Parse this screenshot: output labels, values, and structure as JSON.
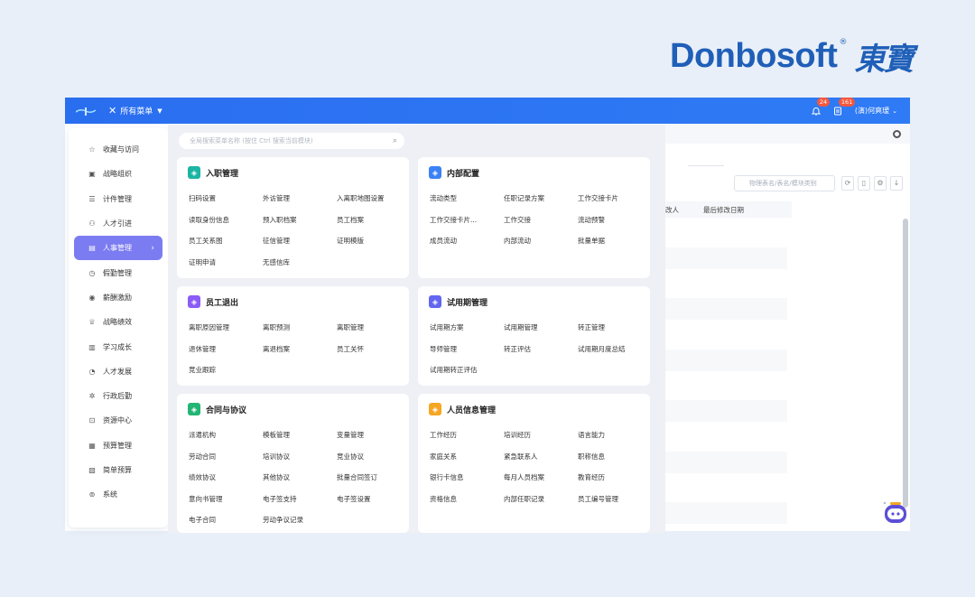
{
  "brand": {
    "name": "Donbosoft",
    "reg": "®",
    "cn": "東寶"
  },
  "colors": {
    "topbar": "#2a6ef0",
    "active": "#7b7cf1",
    "brand": "#1f5fb8",
    "badge": "#f5573d"
  },
  "topbar": {
    "menu_label": "所有菜单",
    "notif_count": "24",
    "tasks_count": "161",
    "user": "(演)何爽瑷"
  },
  "workspace": {
    "search_placeholder": "物理表名/表名/模块类别",
    "col_1": "改人",
    "col_2": "最后修改日期"
  },
  "sidebar": {
    "items": [
      {
        "label": "收藏与访问",
        "icon": "star-icon"
      },
      {
        "label": "战略组织",
        "icon": "org-icon"
      },
      {
        "label": "计件管理",
        "icon": "list-icon"
      },
      {
        "label": "人才引进",
        "icon": "person-icon"
      },
      {
        "label": "人事管理",
        "icon": "person-card-icon"
      },
      {
        "label": "假勤管理",
        "icon": "clock-icon"
      },
      {
        "label": "薪酬激励",
        "icon": "coin-icon"
      },
      {
        "label": "战略绩效",
        "icon": "trophy-icon"
      },
      {
        "label": "学习成长",
        "icon": "book-icon"
      },
      {
        "label": "人才发展",
        "icon": "growth-icon"
      },
      {
        "label": "行政后勤",
        "icon": "gear-icon"
      },
      {
        "label": "资源中心",
        "icon": "box-icon"
      },
      {
        "label": "预算管理",
        "icon": "budget-icon"
      },
      {
        "label": "简单预算",
        "icon": "calc-icon"
      },
      {
        "label": "系统",
        "icon": "settings-icon"
      }
    ]
  },
  "mega": {
    "search_placeholder": "全局搜索菜单名称 (按住 Ctrl 搜索当前模块)",
    "cards": [
      {
        "title": "入职管理",
        "color": "#1cb5a3",
        "items": [
          "扫码设置",
          "外访管理",
          "入离职地图设置",
          "读取身份信息",
          "预入职档案",
          "员工档案",
          "员工关系图",
          "征信管理",
          "证明模版",
          "证明申请",
          "无感信库"
        ]
      },
      {
        "title": "内部配置",
        "color": "#3b82f6",
        "items": [
          "流动类型",
          "任职记录方案",
          "工作交接卡片",
          "工作交接卡片...",
          "工作交接",
          "流动预警",
          "成员流动",
          "内部流动",
          "批量单据"
        ]
      },
      {
        "title": "员工退出",
        "color": "#8b5cf6",
        "items": [
          "离职原因管理",
          "离职预测",
          "离职管理",
          "退休管理",
          "离退档案",
          "员工关怀",
          "竞业跟踪"
        ]
      },
      {
        "title": "试用期管理",
        "color": "#6366f1",
        "items": [
          "试用期方案",
          "试用期管理",
          "转正管理",
          "导师管理",
          "转正评估",
          "试用期月度总结",
          "试用期转正评估"
        ]
      },
      {
        "title": "合同与协议",
        "color": "#22b573",
        "items": [
          "派遣机构",
          "模板管理",
          "变量管理",
          "劳动合同",
          "培训协议",
          "竞业协议",
          "绩效协议",
          "其他协议",
          "批量合同签订",
          "意向书管理",
          "电子签支持",
          "电子签设置",
          "电子合同",
          "劳动争议记录"
        ]
      },
      {
        "title": "人员信息管理",
        "color": "#f5a623",
        "items": [
          "工作经历",
          "培训经历",
          "语言能力",
          "家庭关系",
          "紧急联系人",
          "职称信息",
          "银行卡信息",
          "每月人员档案",
          "教育经历",
          "资格信息",
          "内部任职记录",
          "员工编号管理"
        ]
      }
    ]
  }
}
